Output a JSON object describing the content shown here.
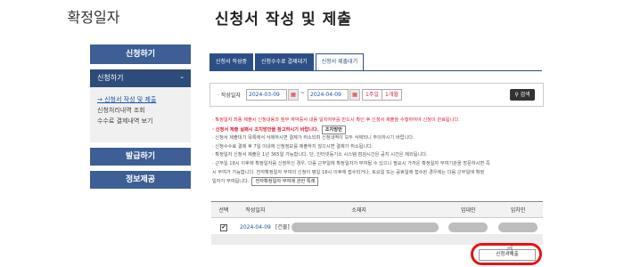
{
  "left_title": "확정일자",
  "sidebar": {
    "header": "신청하기",
    "sub_header": "신청하기",
    "sub_toggle": "-",
    "items": [
      {
        "label": "→ 신청서 작성 및 제출",
        "active": true
      },
      {
        "label": "신청처리내역 조회",
        "active": false
      },
      {
        "label": "수수료 결제내역 보기",
        "active": false
      }
    ],
    "buttons": [
      "발급하기",
      "정보제공"
    ]
  },
  "main_title": "신청서 작성 및 제출",
  "tabs": [
    {
      "label": "신청서 작성중",
      "active": false
    },
    {
      "label": "신청수수료 결제대기",
      "active": false
    },
    {
      "label": "신청서 제출대기",
      "active": true
    }
  ],
  "search": {
    "label": "· 작성일자",
    "start_date": "2024-03-09",
    "end_date": "2024-04-09",
    "tilde": "~",
    "cal_icon": "calendar-icon",
    "month_1": "1주일",
    "month_2": "1개월",
    "search_button": "검색"
  },
  "notes": [
    {
      "text": "· 확정일자 최종 제출시 신청내용과 첨부 계약증서 내용 일치여부를 반드시 확인 후 신청서 제출을 수행하여야 신청이 완료됩니다.",
      "style": "red"
    },
    {
      "text": "· 신청서 제출 실패시 조치방안을 참고하시기 바랍니다.",
      "style": "red-bold",
      "button": "조치방안"
    },
    {
      "text": "· 신청서 제출대기 목록에서 삭제하시면 결제가 취소되며 신청내역이 모두 삭제되니 주의하시기 바랍니다.",
      "style": ""
    },
    {
      "text": "· 신청수수료 결제 후 7일 이내에 신청정보를 제출하지 않으시면 결제가 취소됩니다.",
      "style": ""
    },
    {
      "text": "· 확정일자 신청서 제출은 1년 365일 가능합니다. 단, 인터넷등기소 시스템 점검시간은 공지 시간은 제외됩니다.",
      "style": ""
    },
    {
      "text": "· 근무일 18시 이후에 확정일자를 신청하신 경우, 다음 근무일에 확정일자가 부여될 수 있으니 필요시 가까운 확정일자 부여기관을 방문하시면 즉",
      "style": ""
    },
    {
      "text": "  시 부여가 가능합니다. 전자확정일자 부여의 신청이 평일 18시 이후에 접수되거나, 토요일 또는 공휴일에 접수된 경우에는 다음 근무일에 확정",
      "style": ""
    },
    {
      "text": "  일자가 부여됩니다.",
      "style": "",
      "button": "전자확정일자 부여에 관한 특례"
    }
  ],
  "table": {
    "headers": [
      "선택",
      "작성일자",
      "소재지",
      "임대인",
      "임차인"
    ],
    "rows": [
      {
        "checked": "✔",
        "date": "2024-04-09",
        "address_prefix": "[건물]"
      }
    ]
  },
  "submit_button": "신청서제출",
  "colors": {
    "primary": "#2d4f86",
    "accent_red": "#e41414",
    "link": "#1b54a5"
  }
}
